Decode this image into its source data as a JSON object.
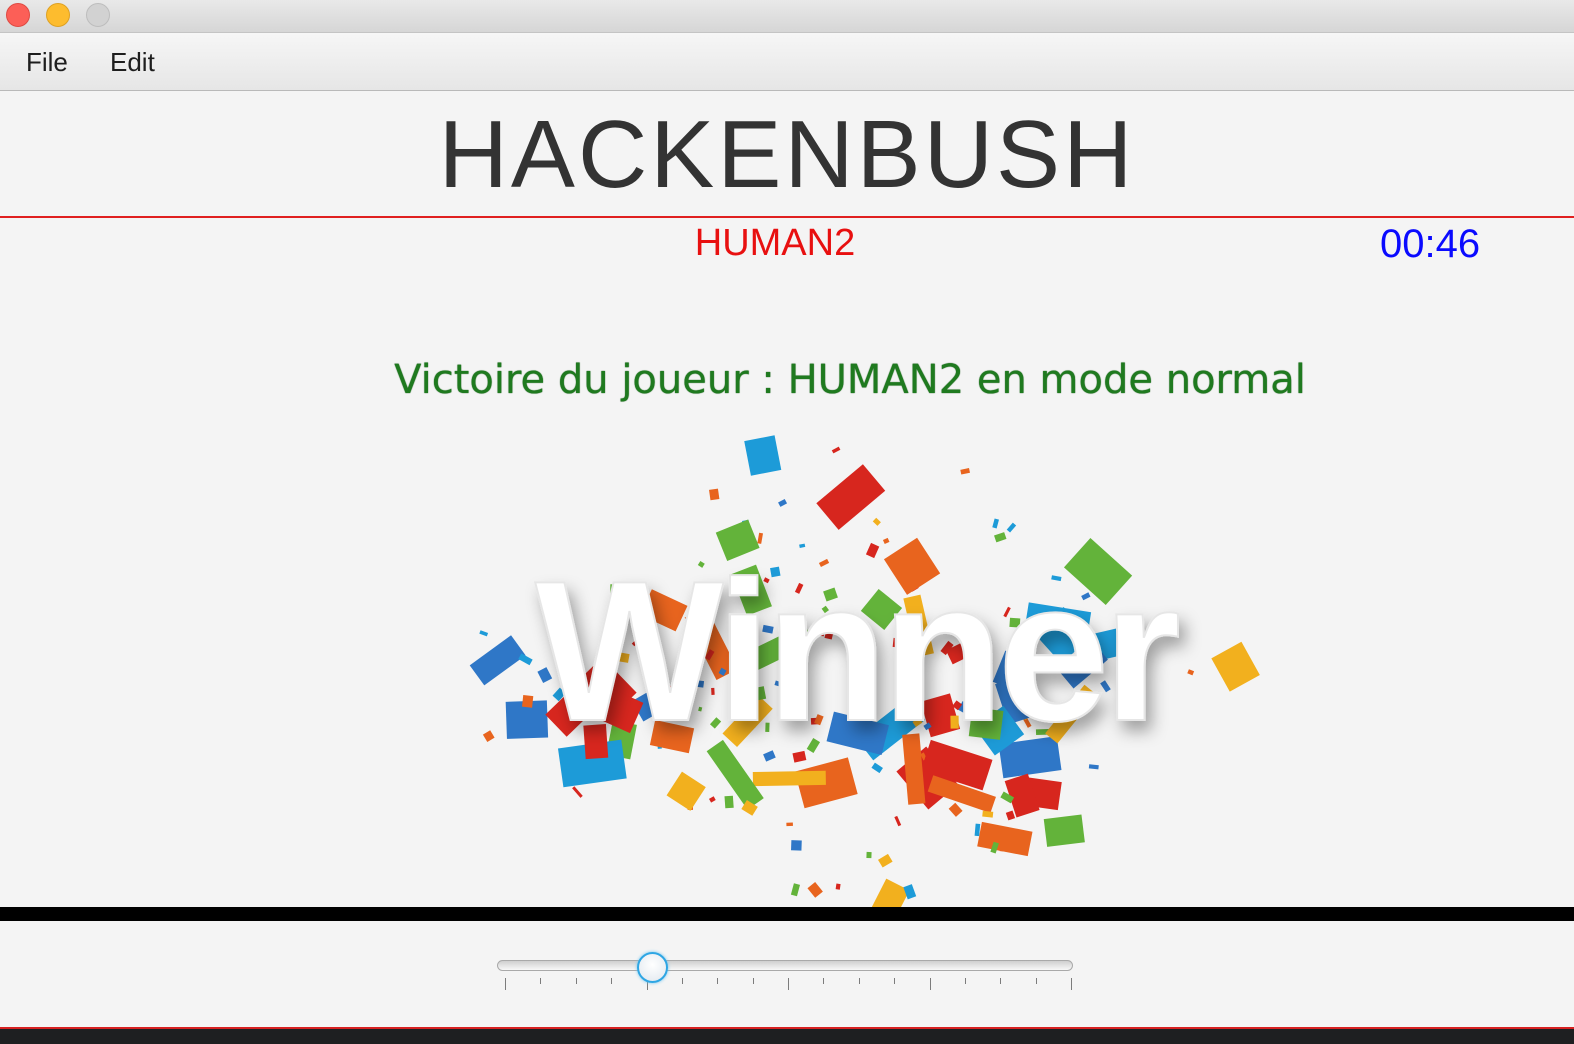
{
  "window": {
    "traffic_lights": [
      "close",
      "minimize",
      "maximize"
    ]
  },
  "menu": {
    "items": [
      {
        "label": "File"
      },
      {
        "label": "Edit"
      }
    ]
  },
  "header": {
    "title": "HACKENBUSH"
  },
  "status": {
    "current_player": "HUMAN2",
    "timer": "00:46"
  },
  "result": {
    "message": "Victoire du joueur : HUMAN2 en mode normal",
    "image_text": "Winner"
  },
  "slider": {
    "value_fraction": 0.26,
    "tick_count": 17
  },
  "colors": {
    "player": "#e81010",
    "timer": "#0a0aff",
    "victory": "#1f7a1f",
    "divider": "#e02020",
    "slider_accent": "#2ea6e4"
  }
}
